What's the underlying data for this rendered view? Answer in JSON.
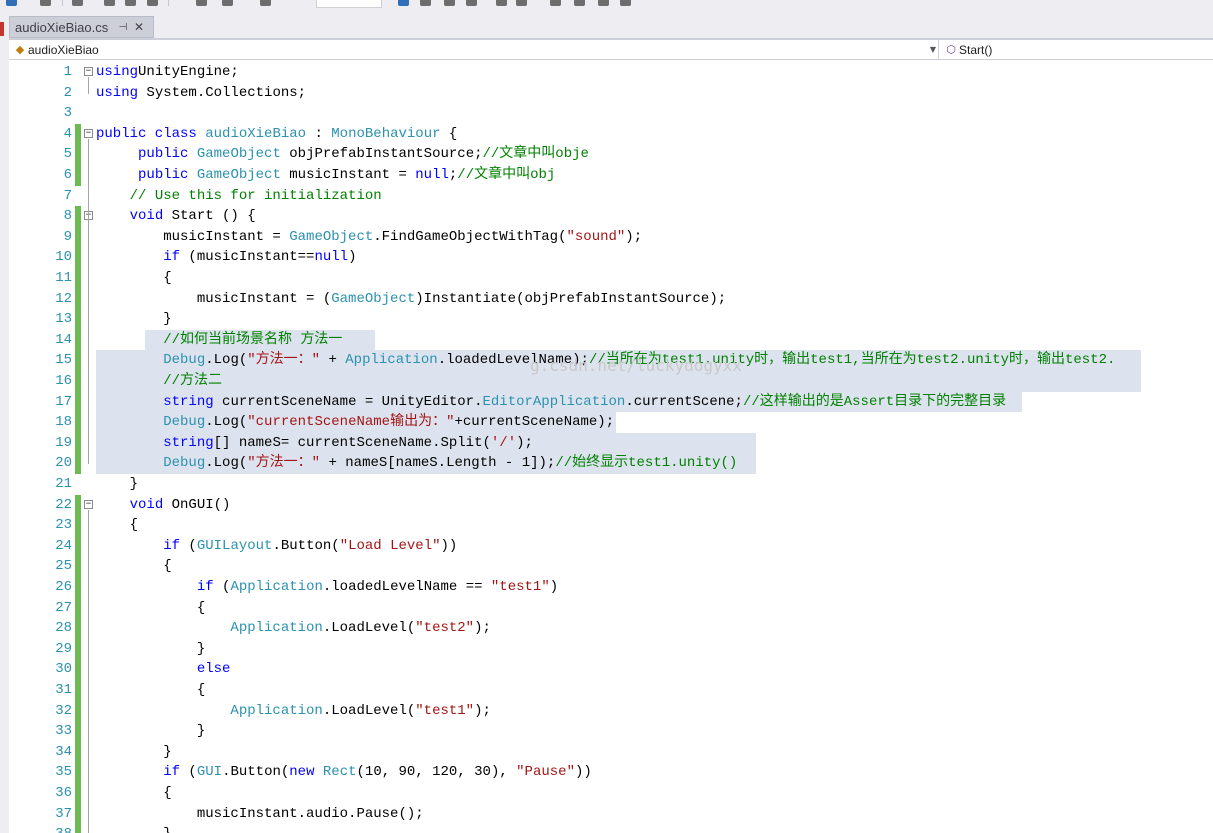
{
  "tab": {
    "title": "audioXieBiao.cs",
    "pin": "⊣",
    "close": "✕"
  },
  "nav": {
    "class_name": "audioXieBiao",
    "member_name": "Start()",
    "class_icon": "class-icon",
    "method_icon": "method-icon"
  },
  "watermark": "g.csdn.net/luckydogyxx",
  "colors": {
    "keyword": "#0000ff",
    "type": "#2b91af",
    "string": "#a31515",
    "comment": "#008000",
    "linenum": "#2b91af",
    "gutter_mark": "#6dba52",
    "selection": "#dde3ee"
  },
  "lines": [
    {
      "n": "1",
      "fold": "−",
      "tokens": [
        [
          "kw",
          "using"
        ],
        [
          "",
          "UnityEngine;"
        ]
      ]
    },
    {
      "n": "2",
      "tokens": [
        [
          "kw",
          "using"
        ],
        [
          "",
          " System.Collections;"
        ]
      ]
    },
    {
      "n": "3",
      "tokens": []
    },
    {
      "n": "4",
      "mark": true,
      "fold": "−",
      "tokens": [
        [
          "kw",
          "public class"
        ],
        [
          "",
          " "
        ],
        [
          "ty",
          "audioXieBiao"
        ],
        [
          "",
          " : "
        ],
        [
          "ty",
          "MonoBehaviour"
        ],
        [
          "",
          " {"
        ]
      ]
    },
    {
      "n": "5",
      "mark": true,
      "tokens": [
        [
          "",
          "     "
        ],
        [
          "kw",
          "public"
        ],
        [
          "",
          " "
        ],
        [
          "ty",
          "GameObject"
        ],
        [
          "",
          " objPrefabInstantSource;"
        ],
        [
          "cm",
          "//文章中叫obje"
        ]
      ]
    },
    {
      "n": "6",
      "mark": true,
      "tokens": [
        [
          "",
          "     "
        ],
        [
          "kw",
          "public"
        ],
        [
          "",
          " "
        ],
        [
          "ty",
          "GameObject"
        ],
        [
          "",
          " musicInstant = "
        ],
        [
          "kw",
          "null"
        ],
        [
          "",
          ";"
        ],
        [
          "cm",
          "//文章中叫obj"
        ]
      ]
    },
    {
      "n": "7",
      "tokens": [
        [
          "",
          "    "
        ],
        [
          "cm",
          "// Use this for initialization"
        ]
      ]
    },
    {
      "n": "8",
      "mark": true,
      "fold": "−",
      "tokens": [
        [
          "",
          "    "
        ],
        [
          "kw",
          "void"
        ],
        [
          "",
          " Start () {"
        ]
      ]
    },
    {
      "n": "9",
      "mark": true,
      "tokens": [
        [
          "",
          "        musicInstant = "
        ],
        [
          "ty",
          "GameObject"
        ],
        [
          "",
          ".FindGameObjectWithTag("
        ],
        [
          "st",
          "\"sound\""
        ],
        [
          "",
          ");"
        ]
      ]
    },
    {
      "n": "10",
      "mark": true,
      "tokens": [
        [
          "",
          "        "
        ],
        [
          "kw",
          "if"
        ],
        [
          "",
          " (musicInstant=="
        ],
        [
          "kw",
          "null"
        ],
        [
          "",
          ")"
        ]
      ]
    },
    {
      "n": "11",
      "mark": true,
      "tokens": [
        [
          "",
          "        {"
        ]
      ]
    },
    {
      "n": "12",
      "mark": true,
      "tokens": [
        [
          "",
          "            musicInstant = ("
        ],
        [
          "ty",
          "GameObject"
        ],
        [
          "",
          ")Instantiate(objPrefabInstantSource);"
        ]
      ]
    },
    {
      "n": "13",
      "mark": true,
      "tokens": [
        [
          "",
          "        }"
        ]
      ]
    },
    {
      "n": "14",
      "mark": true,
      "tokens": [
        [
          "",
          "        "
        ],
        [
          "cm",
          "//如何当前场景名称 方法一"
        ]
      ]
    },
    {
      "n": "15",
      "mark": true,
      "tokens": [
        [
          "",
          "        "
        ],
        [
          "ty",
          "Debug"
        ],
        [
          "",
          ".Log("
        ],
        [
          "st",
          "\"方法一：\""
        ],
        [
          "",
          " + "
        ],
        [
          "ty",
          "Application"
        ],
        [
          "",
          ".loadedLevelName);"
        ],
        [
          "cm",
          "//当所在为test1.unity时，输出test1,当所在为test2.unity时，输出test2."
        ]
      ]
    },
    {
      "n": "16",
      "mark": true,
      "tokens": [
        [
          "",
          "        "
        ],
        [
          "cm",
          "//方法二"
        ]
      ]
    },
    {
      "n": "17",
      "mark": true,
      "tokens": [
        [
          "",
          "        "
        ],
        [
          "kw",
          "string"
        ],
        [
          "",
          " currentSceneName = UnityEditor."
        ],
        [
          "ty",
          "EditorApplication"
        ],
        [
          "",
          ".currentScene;"
        ],
        [
          "cm",
          "//这样输出的是Assert目录下的完整目录"
        ]
      ]
    },
    {
      "n": "18",
      "mark": true,
      "tokens": [
        [
          "",
          "        "
        ],
        [
          "ty",
          "Debug"
        ],
        [
          "",
          ".Log("
        ],
        [
          "st",
          "\"currentSceneName输出为：\""
        ],
        [
          "",
          "+currentSceneName);"
        ]
      ]
    },
    {
      "n": "19",
      "mark": true,
      "tokens": [
        [
          "",
          "        "
        ],
        [
          "kw",
          "string"
        ],
        [
          "",
          "[] nameS= currentSceneName.Split("
        ],
        [
          "st",
          "'/'"
        ],
        [
          "",
          ");"
        ]
      ]
    },
    {
      "n": "20",
      "mark": true,
      "tokens": [
        [
          "",
          "        "
        ],
        [
          "ty",
          "Debug"
        ],
        [
          "",
          ".Log("
        ],
        [
          "st",
          "\"方法一：\""
        ],
        [
          "",
          " + nameS[nameS.Length - 1]);"
        ],
        [
          "cm",
          "//始终显示test1.unity()"
        ]
      ]
    },
    {
      "n": "21",
      "tokens": [
        [
          "",
          "    }"
        ]
      ]
    },
    {
      "n": "22",
      "mark": true,
      "fold": "−",
      "tokens": [
        [
          "",
          "    "
        ],
        [
          "kw",
          "void"
        ],
        [
          "",
          " OnGUI()"
        ]
      ]
    },
    {
      "n": "23",
      "mark": true,
      "tokens": [
        [
          "",
          "    {"
        ]
      ]
    },
    {
      "n": "24",
      "mark": true,
      "tokens": [
        [
          "",
          "        "
        ],
        [
          "kw",
          "if"
        ],
        [
          "",
          " ("
        ],
        [
          "ty",
          "GUILayout"
        ],
        [
          "",
          ".Button("
        ],
        [
          "st",
          "\"Load Level\""
        ],
        [
          "",
          "))"
        ]
      ]
    },
    {
      "n": "25",
      "mark": true,
      "tokens": [
        [
          "",
          "        {"
        ]
      ]
    },
    {
      "n": "26",
      "mark": true,
      "tokens": [
        [
          "",
          "            "
        ],
        [
          "kw",
          "if"
        ],
        [
          "",
          " ("
        ],
        [
          "ty",
          "Application"
        ],
        [
          "",
          ".loadedLevelName == "
        ],
        [
          "st",
          "\"test1\""
        ],
        [
          "",
          ")"
        ]
      ]
    },
    {
      "n": "27",
      "mark": true,
      "tokens": [
        [
          "",
          "            {"
        ]
      ]
    },
    {
      "n": "28",
      "mark": true,
      "tokens": [
        [
          "",
          "                "
        ],
        [
          "ty",
          "Application"
        ],
        [
          "",
          ".LoadLevel("
        ],
        [
          "st",
          "\"test2\""
        ],
        [
          "",
          ");"
        ]
      ]
    },
    {
      "n": "29",
      "mark": true,
      "tokens": [
        [
          "",
          "            }"
        ]
      ]
    },
    {
      "n": "30",
      "mark": true,
      "tokens": [
        [
          "",
          "            "
        ],
        [
          "kw",
          "else"
        ]
      ]
    },
    {
      "n": "31",
      "mark": true,
      "tokens": [
        [
          "",
          "            {"
        ]
      ]
    },
    {
      "n": "32",
      "mark": true,
      "tokens": [
        [
          "",
          "                "
        ],
        [
          "ty",
          "Application"
        ],
        [
          "",
          ".LoadLevel("
        ],
        [
          "st",
          "\"test1\""
        ],
        [
          "",
          ");"
        ]
      ]
    },
    {
      "n": "33",
      "mark": true,
      "tokens": [
        [
          "",
          "            }"
        ]
      ]
    },
    {
      "n": "34",
      "mark": true,
      "tokens": [
        [
          "",
          "        }"
        ]
      ]
    },
    {
      "n": "35",
      "mark": true,
      "tokens": [
        [
          "",
          "        "
        ],
        [
          "kw",
          "if"
        ],
        [
          "",
          " ("
        ],
        [
          "ty",
          "GUI"
        ],
        [
          "",
          ".Button("
        ],
        [
          "kw",
          "new"
        ],
        [
          "",
          " "
        ],
        [
          "ty",
          "Rect"
        ],
        [
          "",
          "(10, 90, 120, 30), "
        ],
        [
          "st",
          "\"Pause\""
        ],
        [
          "",
          "))"
        ]
      ]
    },
    {
      "n": "36",
      "mark": true,
      "tokens": [
        [
          "",
          "        {"
        ]
      ]
    },
    {
      "n": "37",
      "mark": true,
      "tokens": [
        [
          "",
          "            musicInstant.audio.Pause();"
        ]
      ]
    },
    {
      "n": "38",
      "mark": true,
      "tokens": [
        [
          "",
          "        }"
        ]
      ]
    }
  ]
}
